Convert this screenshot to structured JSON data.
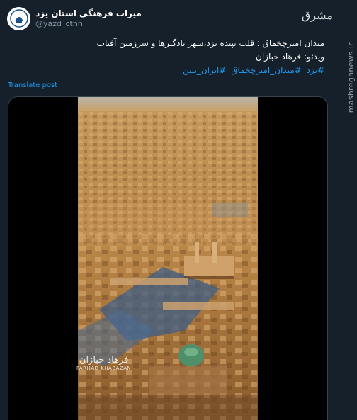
{
  "header": {
    "display_name": "میراث فرهنگی استان یزد",
    "handle": "@yazd_cthh",
    "avatar_icon": "yazd-heritage-logo"
  },
  "watermark": {
    "logo_text": "مشرق",
    "side_text": "mashreghnews.ir"
  },
  "tweet": {
    "line1": "میدان امیرچخماق : قلب تپنده یزد،شهر بادگیرها و سرزمین آفتاب",
    "line2": "ویدئو: فرهاد خبازان",
    "hashtags": [
      "#یزد",
      "#میدان_امیرچخماق",
      "#ایران_ببین"
    ]
  },
  "translate_label": "Translate post",
  "video": {
    "overlay_brand": "FARHAD KHABAZAN"
  },
  "colors": {
    "background": "#15202b",
    "link": "#1d9bf0",
    "muted": "#8899a6"
  }
}
